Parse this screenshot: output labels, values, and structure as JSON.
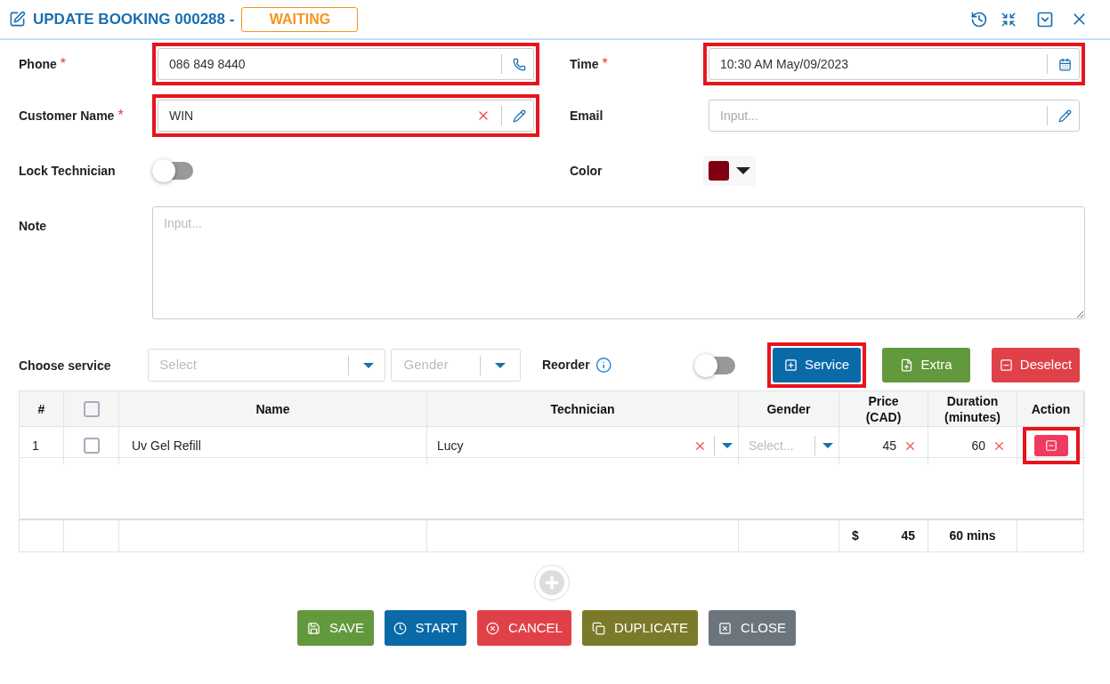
{
  "header": {
    "title": "UPDATE BOOKING 000288 -",
    "status": "WAITING"
  },
  "phone": {
    "label": "Phone",
    "required_mark": "*",
    "value": "086 849 8440",
    "highlighted": true
  },
  "time": {
    "label": "Time",
    "required_mark": "*",
    "value": "10:30 AM May/09/2023",
    "highlighted": true
  },
  "customer_name": {
    "label": "Customer Name",
    "required_mark": "*",
    "value": "WIN",
    "highlighted": true
  },
  "email": {
    "label": "Email",
    "placeholder": "Input...",
    "highlighted": false
  },
  "lock_technician": {
    "label": "Lock Technician",
    "on": false
  },
  "color": {
    "label": "Color",
    "color": "#800012"
  },
  "note": {
    "label": "Note",
    "placeholder": "Input..."
  },
  "choose_service": {
    "label": "Choose service",
    "service_placeholder": "Select",
    "gender_placeholder": "Gender"
  },
  "reorder": {
    "label": "Reorder",
    "on": false
  },
  "service_buttons": [
    {
      "label": "Service",
      "kind": "service",
      "highlighted": true
    },
    {
      "label": "Extra",
      "kind": "extra",
      "highlighted": false
    },
    {
      "label": "Deselect",
      "kind": "deselect",
      "highlighted": false
    }
  ],
  "table": {
    "columns": [
      "#",
      "Name",
      "Technician",
      "Gender",
      "Price\n(CAD)",
      "Duration\n(minutes)",
      "Action"
    ],
    "all_checked": false,
    "rows": [
      {
        "index": "1",
        "checked": false,
        "name": "Uv Gel Refill",
        "technician": "Lucy",
        "gender_placeholder": "Select...",
        "price": "45",
        "duration": "60",
        "action_highlighted": true
      }
    ],
    "footer": {
      "currency": "$",
      "price_total": "45",
      "duration_total": "60 mins"
    }
  },
  "bottom_buttons": [
    {
      "label": "SAVE",
      "kind": "save"
    },
    {
      "label": "START",
      "kind": "start"
    },
    {
      "label": "CANCEL",
      "kind": "cancel"
    },
    {
      "label": "DUPLICATE",
      "kind": "duplicate"
    },
    {
      "label": "CLOSE",
      "kind": "close"
    }
  ]
}
